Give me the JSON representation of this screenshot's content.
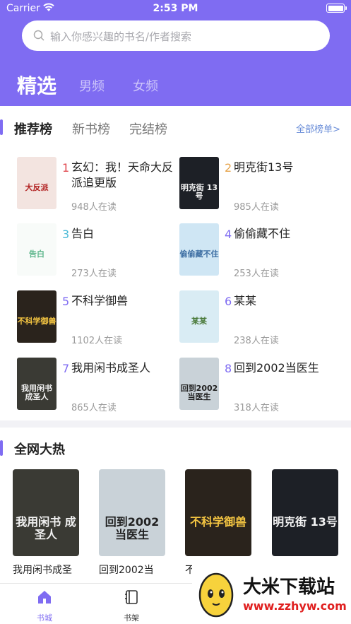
{
  "status": {
    "carrier": "Carrier",
    "time": "2:53 PM"
  },
  "search": {
    "placeholder": "输入你感兴趣的书名/作者搜索"
  },
  "channel_tabs": [
    "精选",
    "男频",
    "女频"
  ],
  "ranking": {
    "tabs": [
      "推荐榜",
      "新书榜",
      "完结榜"
    ],
    "all_link": "全部榜单>",
    "books": [
      {
        "rank": "1",
        "title": "玄幻：我！天命大反派追更版",
        "reads": "948人在读",
        "rank_color": "#e0484f",
        "cover_text": "大反派",
        "cover_bg": "#f3e4e0",
        "cover_fg": "#b22222"
      },
      {
        "rank": "2",
        "title": "明克街13号",
        "reads": "985人在读",
        "rank_color": "#e6a34a",
        "cover_text": "明克街 13号",
        "cover_bg": "#1d2026",
        "cover_fg": "#f2f2f2"
      },
      {
        "rank": "3",
        "title": "告白",
        "reads": "273人在读",
        "rank_color": "#49b9d6",
        "cover_text": "告白",
        "cover_bg": "#f8fbf9",
        "cover_fg": "#5bb58a"
      },
      {
        "rank": "4",
        "title": "偷偷藏不住",
        "reads": "253人在读",
        "rank_color": "#7f6cf2",
        "cover_text": "偷偷藏不住",
        "cover_bg": "#cfe6f4",
        "cover_fg": "#3e6fa3"
      },
      {
        "rank": "5",
        "title": "不科学御兽",
        "reads": "1102人在读",
        "rank_color": "#7f6cf2",
        "cover_text": "不科学御兽",
        "cover_bg": "#2a231c",
        "cover_fg": "#f4c542"
      },
      {
        "rank": "6",
        "title": "某某",
        "reads": "238人在读",
        "rank_color": "#7f6cf2",
        "cover_text": "某某",
        "cover_bg": "#d9ecf4",
        "cover_fg": "#4a7a3a"
      },
      {
        "rank": "7",
        "title": "我用闲书成圣人",
        "reads": "865人在读",
        "rank_color": "#7f6cf2",
        "cover_text": "我用闲书 成圣人",
        "cover_bg": "#3a3a34",
        "cover_fg": "#f1f1f1"
      },
      {
        "rank": "8",
        "title": "回到2002当医生",
        "reads": "318人在读",
        "rank_color": "#7f6cf2",
        "cover_text": "回到2002 当医生",
        "cover_bg": "#c9d2d8",
        "cover_fg": "#222"
      }
    ]
  },
  "hot": {
    "title": "全网大热",
    "books": [
      {
        "name": "我用闲书成圣",
        "cover_text": "我用闲书 成圣人",
        "cover_bg": "#3a3a34",
        "cover_fg": "#f1f1f1"
      },
      {
        "name": "回到2002当",
        "cover_text": "回到2002 当医生",
        "cover_bg": "#c9d2d8",
        "cover_fg": "#222"
      },
      {
        "name": "不",
        "cover_text": "不科学御兽",
        "cover_bg": "#2a231c",
        "cover_fg": "#f4c542"
      },
      {
        "name": "",
        "cover_text": "明克街 13号",
        "cover_bg": "#1d2026",
        "cover_fg": "#f2f2f2"
      }
    ]
  },
  "tabbar": {
    "items": [
      "书城",
      "书架"
    ],
    "active_color": "#7f6cf2"
  },
  "watermark": {
    "title": "大米下载站",
    "url": "www.zzhyw.com"
  },
  "colors": {
    "accent": "#7f6cf2"
  }
}
